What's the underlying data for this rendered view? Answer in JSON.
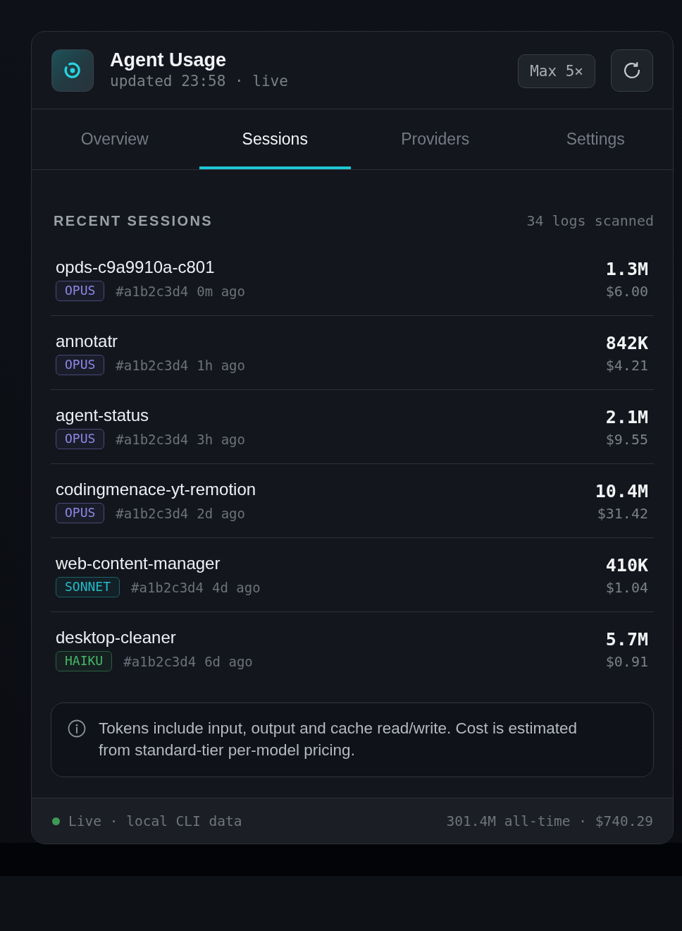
{
  "header": {
    "title": "Agent Usage",
    "subtitle": "updated 23:58 · live",
    "plan": "Max 5×"
  },
  "tabs": [
    {
      "label": "Overview",
      "selected": false
    },
    {
      "label": "Sessions",
      "selected": true
    },
    {
      "label": "Providers",
      "selected": false
    },
    {
      "label": "Settings",
      "selected": false
    }
  ],
  "sessions_header": {
    "title": "RECENT SESSIONS",
    "count": "34 logs scanned"
  },
  "sessions": [
    {
      "name": "opds-c9a9910a-c801",
      "model": "OPUS",
      "color": "#8f86e8",
      "hash": "#a1b2c3d4",
      "age": "0m ago",
      "tokens": "1.3M",
      "cost": "$6.00"
    },
    {
      "name": "annotatr",
      "model": "OPUS",
      "color": "#8f86e8",
      "hash": "#a1b2c3d4",
      "age": "1h ago",
      "tokens": "842K",
      "cost": "$4.21"
    },
    {
      "name": "agent-status",
      "model": "OPUS",
      "color": "#8f86e8",
      "hash": "#a1b2c3d4",
      "age": "3h ago",
      "tokens": "2.1M",
      "cost": "$9.55"
    },
    {
      "name": "codingmenace-yt-remotion",
      "model": "OPUS",
      "color": "#8f86e8",
      "hash": "#a1b2c3d4",
      "age": "2d ago",
      "tokens": "10.4M",
      "cost": "$31.42"
    },
    {
      "name": "web-content-manager",
      "model": "SONNET",
      "color": "#22bcc9",
      "hash": "#a1b2c3d4",
      "age": "4d ago",
      "tokens": "410K",
      "cost": "$1.04"
    },
    {
      "name": "desktop-cleaner",
      "model": "HAIKU",
      "color": "#45b866",
      "hash": "#a1b2c3d4",
      "age": "6d ago",
      "tokens": "5.7M",
      "cost": "$0.91"
    }
  ],
  "note": "Tokens include input, output and cache read/write. Cost is estimated from standard-tier per-model pricing.",
  "status_bar": {
    "left": "Live · local CLI data",
    "right": "301.4M all-time · $740.29"
  }
}
